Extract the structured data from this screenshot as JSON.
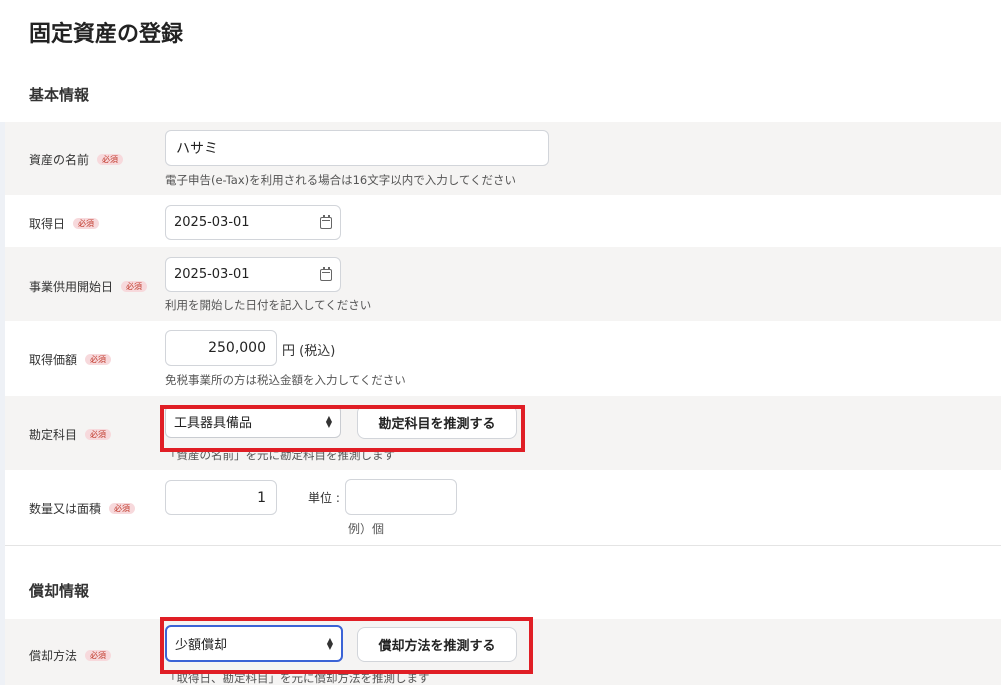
{
  "page": {
    "title": "固定資産の登録"
  },
  "sections": {
    "basic": "基本情報",
    "depreciation": "償却情報"
  },
  "required_label": "必須",
  "fields": {
    "asset_name": {
      "label": "資産の名前",
      "value": "ハサミ",
      "help": "電子申告(e-Tax)を利用される場合は16文字以内で入力してください"
    },
    "acquisition_date": {
      "label": "取得日",
      "value": "2025-03-01"
    },
    "service_start_date": {
      "label": "事業供用開始日",
      "value": "2025-03-01",
      "help": "利用を開始した日付を記入してください"
    },
    "acquisition_price": {
      "label": "取得価額",
      "value": "250,000",
      "unit": "円 (税込)",
      "help": "免税事業所の方は税込金額を入力してください"
    },
    "account": {
      "label": "勘定科目",
      "selected": "工具器具備品",
      "button": "勘定科目を推測する",
      "help": "「資産の名前」を元に勘定科目を推測します"
    },
    "quantity": {
      "label": "数量又は面積",
      "value": "1",
      "unit_label": "単位 :",
      "unit_value": "",
      "unit_help": "例）個"
    },
    "method": {
      "label": "償却方法",
      "selected": "少額償却",
      "button": "償却方法を推測する",
      "help": "「取得日、勘定科目」を元に償却方法を推測します"
    }
  },
  "colors": {
    "highlight": "#e01e25",
    "badge_bg": "#f7d9dc",
    "badge_text": "#c0392b",
    "focus": "#3b63d6",
    "row_shade": "#f5f4f3"
  }
}
